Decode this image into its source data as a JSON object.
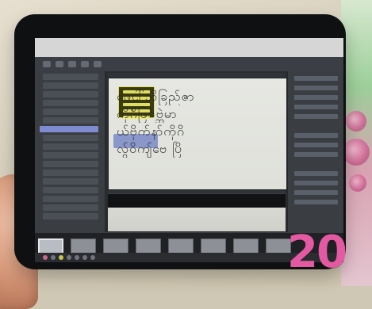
{
  "page": {
    "page_number": "20"
  },
  "doc": {
    "lines": [
      "ဖေငါ်ဘိခြည်ဇာ",
      "ကိုဂ်ိဖြ်ဗ္ဘဲမာ",
      "ယ်ဗိုက်နာ်ကိုဂိ",
      "လ်ွဝိကျ်ဗေ ပြိ"
    ]
  }
}
